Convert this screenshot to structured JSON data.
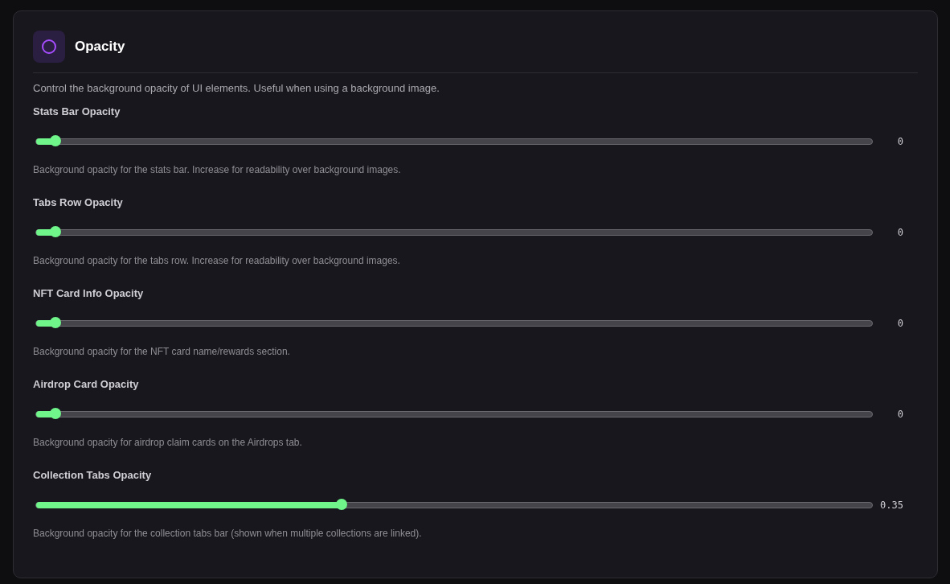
{
  "panel": {
    "title": "Opacity",
    "description": "Control the background opacity of UI elements. Useful when using a background image."
  },
  "sliders": [
    {
      "label": "Stats Bar Opacity",
      "level": 0,
      "reading": "0",
      "help": "Background opacity for the stats bar. Increase for readability over background images."
    },
    {
      "label": "Tabs Row Opacity",
      "level": 0,
      "reading": "0",
      "help": "Background opacity for the tabs row. Increase for readability over background images."
    },
    {
      "label": "NFT Card Info Opacity",
      "level": 0,
      "reading": "0",
      "help": "Background opacity for the NFT card name/rewards section."
    },
    {
      "label": "Airdrop Card Opacity",
      "level": 0,
      "reading": "0",
      "help": "Background opacity for airdrop claim cards on the Airdrops tab."
    },
    {
      "label": "Collection Tabs Opacity",
      "level": 0.35,
      "reading": "0.35",
      "help": "Background opacity for the collection tabs bar (shown when multiple collections are linked)."
    }
  ]
}
